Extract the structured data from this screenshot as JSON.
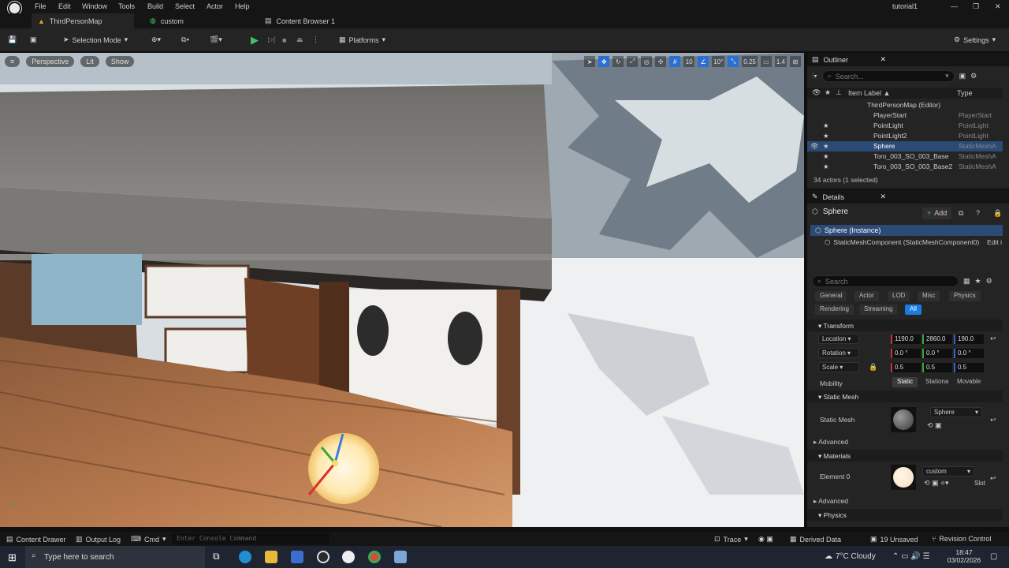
{
  "window": {
    "title": "tutorial1"
  },
  "menu": [
    "File",
    "Edit",
    "Window",
    "Tools",
    "Build",
    "Select",
    "Actor",
    "Help"
  ],
  "tabs": [
    {
      "label": "ThirdPersonMap",
      "active": true
    },
    {
      "label": "custom"
    },
    {
      "label": "Content Browser 1"
    }
  ],
  "toolbar": {
    "selection_mode": "Selection Mode",
    "platforms": "Platforms",
    "settings": "Settings"
  },
  "viewport": {
    "perspective": "Perspective",
    "lit": "Lit",
    "show": "Show",
    "grid_snap": "10",
    "rot_snap": "10°",
    "scale_snap": "0.25",
    "cam_speed": "1.4"
  },
  "outliner": {
    "title": "Outliner",
    "search_placeholder": "Search...",
    "col_label": "Item Label ▲",
    "col_type": "Type",
    "rows": [
      {
        "label": "ThirdPersonMap (Editor)",
        "type": ""
      },
      {
        "label": "PlayerStart",
        "type": "PlayerStart"
      },
      {
        "label": "PointLight",
        "type": "PointLight"
      },
      {
        "label": "PointLight2",
        "type": "PointLight"
      },
      {
        "label": "Sphere",
        "type": "StaticMeshA"
      },
      {
        "label": "Toro_003_SO_003_Base",
        "type": "StaticMeshA"
      },
      {
        "label": "Toro_003_SO_003_Base2",
        "type": "StaticMeshA"
      }
    ],
    "footer": "34 actors (1 selected)"
  },
  "details": {
    "title": "Details",
    "actor_name": "Sphere",
    "add_label": "Add",
    "instance_label": "Sphere (Instance)",
    "component_label": "StaticMeshComponent (StaticMeshComponent0)",
    "edit_label": "Edit i",
    "search_placeholder": "Search",
    "filters_row1": [
      "General",
      "Actor",
      "LOD",
      "Misc",
      "Physics"
    ],
    "filters_row2": [
      "Rendering",
      "Streaming",
      "All"
    ],
    "transform_head": "Transform",
    "location_label": "Location",
    "rotation_label": "Rotation",
    "scale_label": "Scale",
    "location": [
      "1190.0",
      "2860.0",
      "190.0"
    ],
    "rotation": [
      "0.0 °",
      "0.0 °",
      "0.0 °"
    ],
    "scale": [
      "0.5",
      "0.5",
      "0.5"
    ],
    "mobility_label": "Mobility",
    "mobility_options": [
      "Static",
      "Stationa",
      "Movable"
    ],
    "static_mesh_head": "Static Mesh",
    "static_mesh_label": "Static Mesh",
    "static_mesh_value": "Sphere",
    "advanced1": "Advanced",
    "materials_head": "Materials",
    "element0_label": "Element 0",
    "material_value": "custom",
    "slot_label": "Slot",
    "advanced2": "Advanced",
    "physics_head": "Physics"
  },
  "statusbar": {
    "content_drawer": "Content Drawer",
    "output_log": "Output Log",
    "cmd": "Cmd",
    "console_placeholder": "Enter Console Command",
    "trace": "Trace",
    "derived_data": "Derived Data",
    "unsaved": "19 Unsaved",
    "revision": "Revision Control"
  },
  "taskbar": {
    "search_placeholder": "Type here to search",
    "weather": "7°C  Cloudy",
    "time": "18:47",
    "date": "03/02/2026"
  }
}
